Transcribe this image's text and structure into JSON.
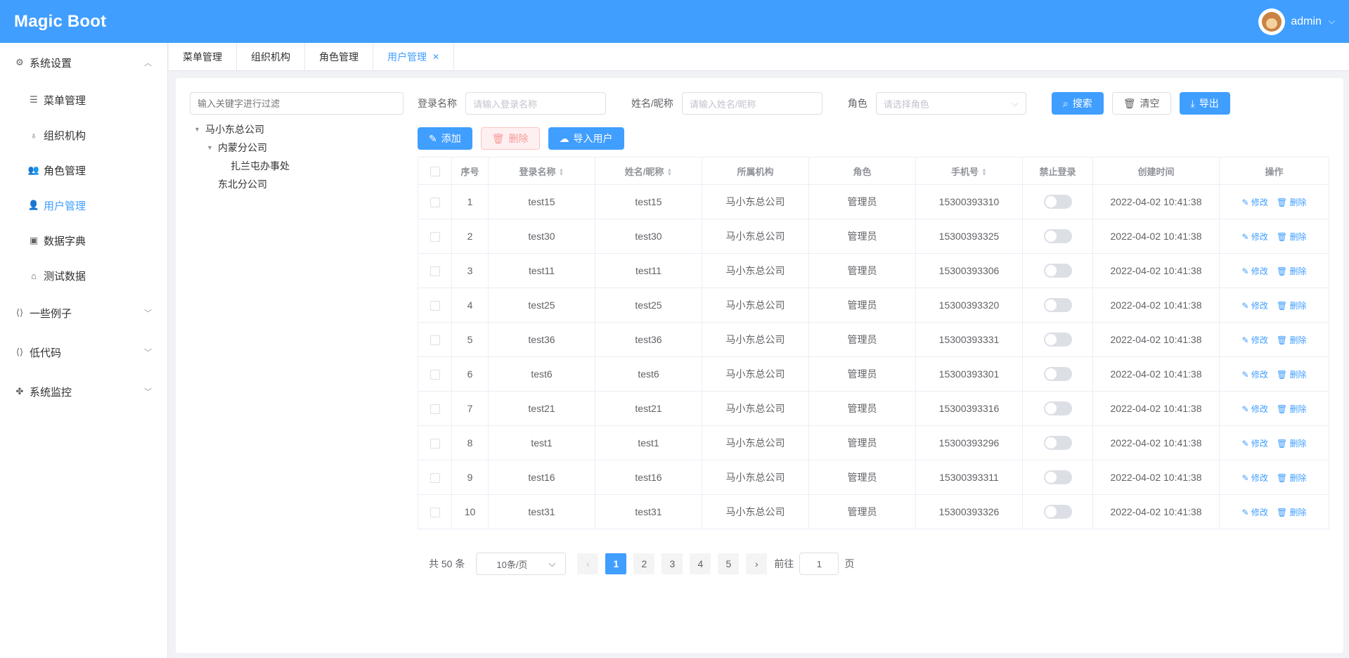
{
  "app": {
    "logo": "Magic Boot",
    "user": "admin"
  },
  "sidebar": {
    "group_settings": "系统设置",
    "items": [
      {
        "label": "菜单管理",
        "icon": "list-icon",
        "active": false
      },
      {
        "label": "组织机构",
        "icon": "org-tree-icon",
        "active": false
      },
      {
        "label": "角色管理",
        "icon": "user-group-icon",
        "active": false
      },
      {
        "label": "用户管理",
        "icon": "user-icon",
        "active": true
      },
      {
        "label": "数据字典",
        "icon": "dictionary-icon",
        "active": false
      },
      {
        "label": "测试数据",
        "icon": "home-icon",
        "active": false
      }
    ],
    "groups": [
      "一些例子",
      "低代码",
      "系统监控"
    ]
  },
  "tabs": [
    "菜单管理",
    "组织机构",
    "角色管理",
    "用户管理"
  ],
  "tree": {
    "filter_placeholder": "输入关键字进行过滤",
    "root": "马小东总公司",
    "child1": "内蒙分公司",
    "grandchild": "扎兰屯办事处",
    "child2": "东北分公司"
  },
  "search": {
    "login_label": "登录名称",
    "login_placeholder": "请输入登录名称",
    "name_label": "姓名/昵称",
    "name_placeholder": "请输入姓名/昵称",
    "role_label": "角色",
    "role_placeholder": "请选择角色",
    "search_btn": "搜索",
    "clear_btn": "清空",
    "export_btn": "导出"
  },
  "actions": {
    "add": "添加",
    "delete": "删除",
    "import": "导入用户"
  },
  "table": {
    "headers": [
      "序号",
      "登录名称",
      "姓名/昵称",
      "所属机构",
      "角色",
      "手机号",
      "禁止登录",
      "创建时间",
      "操作"
    ],
    "edit_label": "修改",
    "delete_label": "删除",
    "rows": [
      {
        "no": "1",
        "login": "test15",
        "name": "test15",
        "org": "马小东总公司",
        "role": "管理员",
        "phone": "15300393310",
        "created": "2022-04-02 10:41:38"
      },
      {
        "no": "2",
        "login": "test30",
        "name": "test30",
        "org": "马小东总公司",
        "role": "管理员",
        "phone": "15300393325",
        "created": "2022-04-02 10:41:38"
      },
      {
        "no": "3",
        "login": "test11",
        "name": "test11",
        "org": "马小东总公司",
        "role": "管理员",
        "phone": "15300393306",
        "created": "2022-04-02 10:41:38"
      },
      {
        "no": "4",
        "login": "test25",
        "name": "test25",
        "org": "马小东总公司",
        "role": "管理员",
        "phone": "15300393320",
        "created": "2022-04-02 10:41:38"
      },
      {
        "no": "5",
        "login": "test36",
        "name": "test36",
        "org": "马小东总公司",
        "role": "管理员",
        "phone": "15300393331",
        "created": "2022-04-02 10:41:38"
      },
      {
        "no": "6",
        "login": "test6",
        "name": "test6",
        "org": "马小东总公司",
        "role": "管理员",
        "phone": "15300393301",
        "created": "2022-04-02 10:41:38"
      },
      {
        "no": "7",
        "login": "test21",
        "name": "test21",
        "org": "马小东总公司",
        "role": "管理员",
        "phone": "15300393316",
        "created": "2022-04-02 10:41:38"
      },
      {
        "no": "8",
        "login": "test1",
        "name": "test1",
        "org": "马小东总公司",
        "role": "管理员",
        "phone": "15300393296",
        "created": "2022-04-02 10:41:38"
      },
      {
        "no": "9",
        "login": "test16",
        "name": "test16",
        "org": "马小东总公司",
        "role": "管理员",
        "phone": "15300393311",
        "created": "2022-04-02 10:41:38"
      },
      {
        "no": "10",
        "login": "test31",
        "name": "test31",
        "org": "马小东总公司",
        "role": "管理员",
        "phone": "15300393326",
        "created": "2022-04-02 10:41:38"
      }
    ]
  },
  "pager": {
    "total": "共 50 条",
    "size": "10条/页",
    "pages": [
      "1",
      "2",
      "3",
      "4",
      "5"
    ],
    "current": "1",
    "goto": "前往",
    "goto_value": "1",
    "page_unit": "页"
  },
  "colors": {
    "primary": "#409eff",
    "danger": "#f56c6c"
  }
}
